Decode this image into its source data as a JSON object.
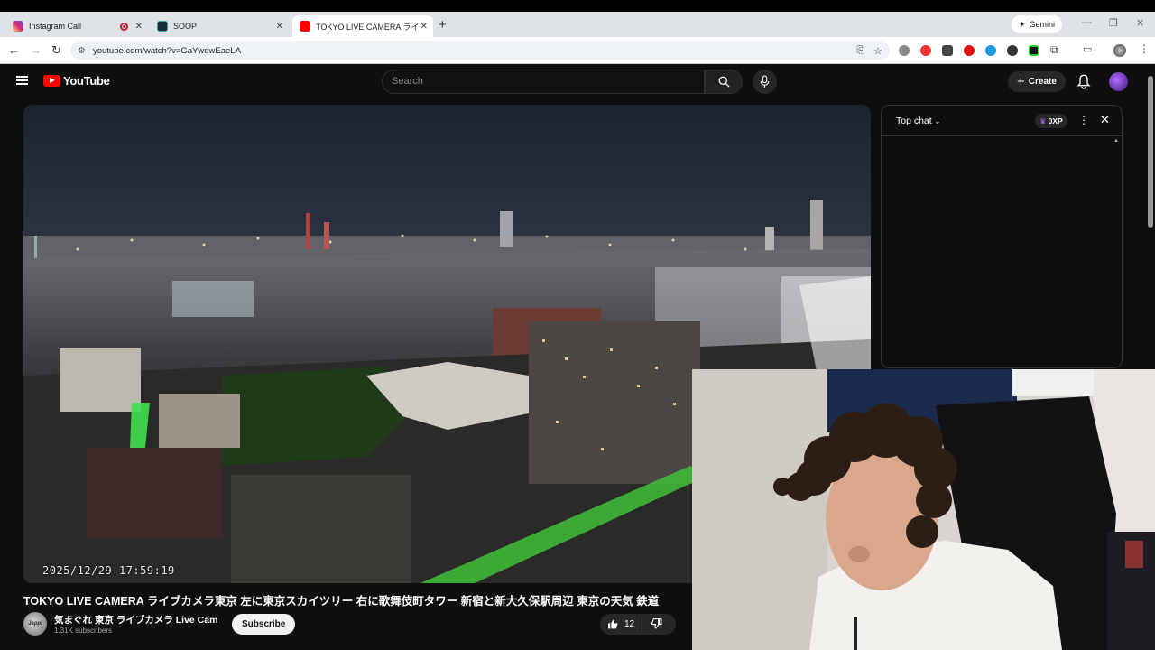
{
  "browser": {
    "tabs": [
      {
        "title": "Instagram Call",
        "favicon_color": "#d62976",
        "recording": true
      },
      {
        "title": "SOOP",
        "favicon_color": "#1b2a3a",
        "recording": false
      },
      {
        "title": "TOKYO LIVE CAMERA ライブカメ",
        "favicon_color": "#ff0000",
        "recording": false,
        "active": true
      }
    ],
    "new_tab_label": "+",
    "gemini_label": "Gemini",
    "url": "youtube.com/watch?v=GaYwdwEaeLA"
  },
  "youtube": {
    "logo_text": "YouTube",
    "search_placeholder": "Search",
    "create_label": "Create"
  },
  "video": {
    "timestamp": "2025/12/29  17:59:19"
  },
  "chat": {
    "title": "Top chat",
    "xp_label": "0XP"
  },
  "meta": {
    "title": "TOKYO LIVE CAMERA ライブカメラ東京 左に東京スカイツリー 右に歌舞伎町タワー 新宿と新大久保駅周辺 東京の天気 鉄道",
    "channel_name": "気まぐれ 東京 ライブカメラ Live Cam",
    "subscribers": "1.31K subscribers",
    "channel_avatar_text": "Jappi",
    "subscribe_label": "Subscribe",
    "like_count": "12"
  }
}
